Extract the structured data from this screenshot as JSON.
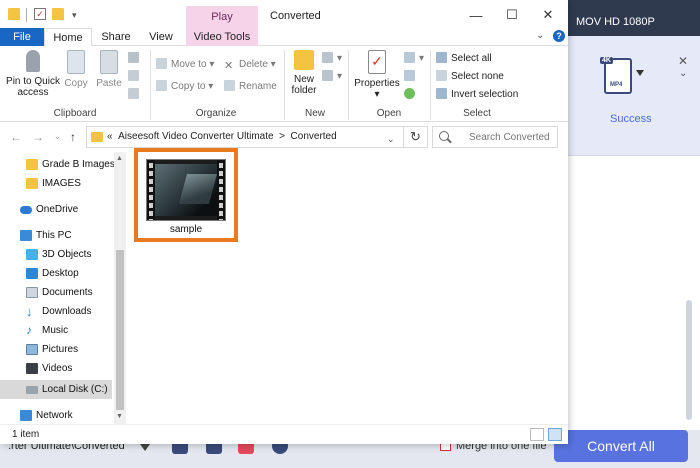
{
  "app": {
    "format_label": "MOV HD 1080P",
    "badge_4k": "4K",
    "badge_mp4": "MP4",
    "status": "Success",
    "output_path": ".rter Ultimate\\Converted",
    "merge_label": "Merge into one file",
    "convert_all_label": "Convert All",
    "accent_color": "#5873e0"
  },
  "window": {
    "title": "Converted",
    "context_tab": "Play",
    "buttons": {
      "minimize": "—",
      "maximize": "☐",
      "close": "✕"
    }
  },
  "tabs": {
    "file": "File",
    "home": "Home",
    "share": "Share",
    "view": "View",
    "video_tools": "Video Tools"
  },
  "ribbon": {
    "clipboard": {
      "pin_label_1": "Pin to Quick",
      "pin_label_2": "access",
      "copy": "Copy",
      "paste": "Paste",
      "group": "Clipboard"
    },
    "organize": {
      "move_to": "Move to",
      "copy_to": "Copy to",
      "delete": "Delete",
      "rename": "Rename",
      "group": "Organize"
    },
    "new": {
      "new_folder_1": "New",
      "new_folder_2": "folder",
      "group": "New"
    },
    "open": {
      "properties": "Properties",
      "group": "Open"
    },
    "select": {
      "select_all": "Select all",
      "select_none": "Select none",
      "invert": "Invert selection",
      "group": "Select"
    }
  },
  "address": {
    "prefix": "«",
    "crumb1": "Aiseesoft Video Converter Ultimate",
    "sep": ">",
    "crumb2": "Converted",
    "search_placeholder": "Search Converted"
  },
  "nav": {
    "items": [
      {
        "label": "Grade B Imagess"
      },
      {
        "label": "IMAGES"
      },
      {
        "label": "OneDrive"
      },
      {
        "label": "This PC"
      },
      {
        "label": "3D Objects"
      },
      {
        "label": "Desktop"
      },
      {
        "label": "Documents"
      },
      {
        "label": "Downloads"
      },
      {
        "label": "Music"
      },
      {
        "label": "Pictures"
      },
      {
        "label": "Videos"
      },
      {
        "label": "Local Disk (C:)"
      },
      {
        "label": "Network"
      }
    ]
  },
  "files": [
    {
      "name": "sample"
    }
  ],
  "status": {
    "count": "1 item"
  }
}
